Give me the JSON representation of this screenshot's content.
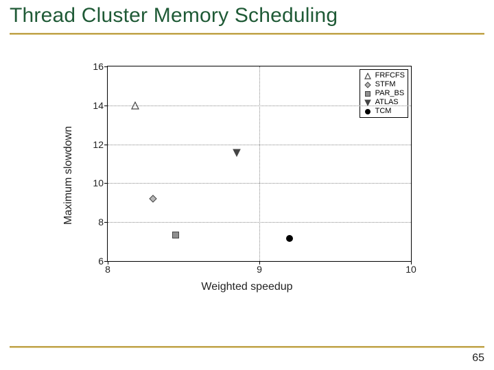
{
  "title": "Thread Cluster Memory Scheduling",
  "page_number": "65",
  "chart_data": {
    "type": "scatter",
    "xlabel": "Weighted speedup",
    "ylabel": "Maximum slowdown",
    "xlim": [
      8,
      10
    ],
    "ylim": [
      6,
      16
    ],
    "xticks": [
      8,
      9,
      10
    ],
    "yticks": [
      6,
      8,
      10,
      12,
      14,
      16
    ],
    "grid": true,
    "legend_position": "upper-right",
    "series": [
      {
        "name": "FRFCFS",
        "marker": "triangle-up-open",
        "color": "#444444",
        "fill": "none",
        "points": [
          {
            "x": 8.18,
            "y": 14.0
          }
        ]
      },
      {
        "name": "STFM",
        "marker": "diamond",
        "color": "#444444",
        "fill": "#b7b7b7",
        "points": [
          {
            "x": 8.3,
            "y": 9.2
          }
        ]
      },
      {
        "name": "PAR_BS",
        "marker": "square",
        "color": "#444444",
        "fill": "#8f8f8f",
        "points": [
          {
            "x": 8.45,
            "y": 7.35
          }
        ]
      },
      {
        "name": "ATLAS",
        "marker": "triangle-down",
        "color": "#444444",
        "fill": "#444444",
        "points": [
          {
            "x": 8.85,
            "y": 11.55
          }
        ]
      },
      {
        "name": "TCM",
        "marker": "circle",
        "color": "#000000",
        "fill": "#000000",
        "points": [
          {
            "x": 9.2,
            "y": 7.15
          }
        ]
      }
    ]
  }
}
